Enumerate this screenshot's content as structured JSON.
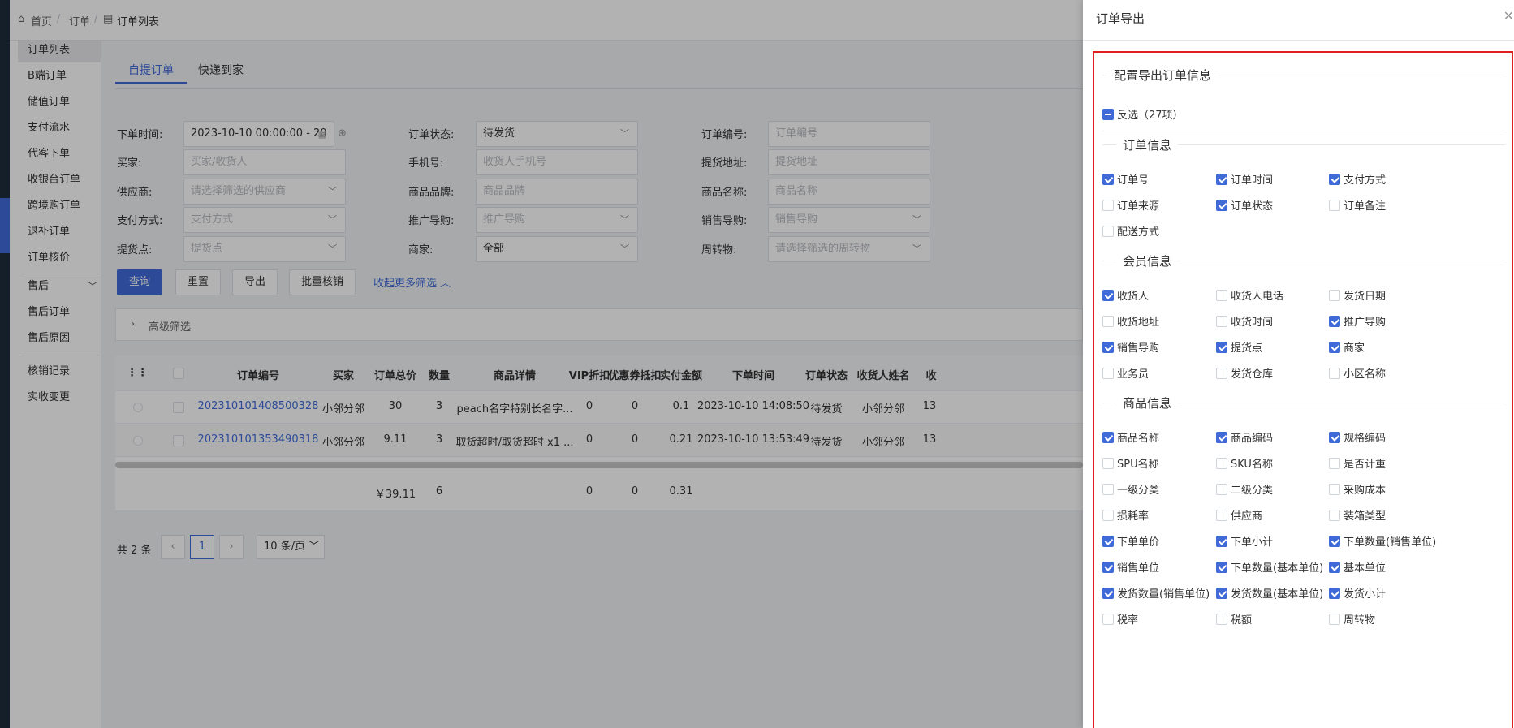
{
  "breadcrumb": [
    "首页",
    "订单",
    "订单列表"
  ],
  "sidebar": {
    "items": [
      "订单列表",
      "B端订单",
      "储值订单",
      "支付流水",
      "代客下单",
      "收银台订单",
      "跨境购订单",
      "退补订单",
      "订单核价",
      "售后",
      "售后订单",
      "售后原因",
      "核销记录",
      "实收变更"
    ]
  },
  "tabs": [
    "自提订单",
    "快递到家"
  ],
  "filters": {
    "order_time": {
      "label": "下单时间:",
      "value": "2023-10-10 00:00:00 - 20"
    },
    "order_status": {
      "label": "订单状态:",
      "value": "待发货"
    },
    "order_no": {
      "label": "订单编号:",
      "placeholder": "订单编号"
    },
    "buyer": {
      "label": "买家:",
      "placeholder": "买家/收货人"
    },
    "phone": {
      "label": "手机号:",
      "placeholder": "收货人手机号"
    },
    "pickup_addr": {
      "label": "提货地址:",
      "placeholder": "提货地址"
    },
    "supplier": {
      "label": "供应商:",
      "placeholder": "请选择筛选的供应商"
    },
    "brand": {
      "label": "商品品牌:",
      "placeholder": "商品品牌"
    },
    "product_name": {
      "label": "商品名称:",
      "placeholder": "商品名称"
    },
    "pay_method": {
      "label": "支付方式:",
      "placeholder": "支付方式"
    },
    "promoter": {
      "label": "推广导购:",
      "placeholder": "推广导购"
    },
    "sales_guide": {
      "label": "销售导购:",
      "placeholder": "销售导购"
    },
    "pickup_point": {
      "label": "提货点:",
      "placeholder": "提货点"
    },
    "merchant": {
      "label": "商家:",
      "value": "全部"
    },
    "turnover": {
      "label": "周转物:",
      "placeholder": "请选择筛选的周转物"
    }
  },
  "buttons": {
    "query": "查询",
    "reset": "重置",
    "export": "导出",
    "batch": "批量核销",
    "collapse": "收起更多筛选"
  },
  "advanced": "高级筛选",
  "table": {
    "headers": [
      "订单编号",
      "买家",
      "订单总价",
      "数量",
      "商品详情",
      "VIP折扣",
      "优惠券抵扣",
      "实付金额",
      "下单时间",
      "订单状态",
      "收货人姓名",
      "收"
    ],
    "rows": [
      [
        "202310101408500328",
        "小邻分邻",
        "30",
        "3",
        "peach名字特别长名字...",
        "0",
        "0",
        "0.1",
        "2023-10-10 14:08:50",
        "待发货",
        "小邻分邻",
        "13"
      ],
      [
        "202310101353490318",
        "小邻分邻",
        "9.11",
        "3",
        "取货超时/取货超时 x1 ...",
        "0",
        "0",
        "0.21",
        "2023-10-10 13:53:49",
        "待发货",
        "小邻分邻",
        "13"
      ]
    ],
    "summary": {
      "total": "￥39.11",
      "qty": "6",
      "vip": "0",
      "coupon": "0",
      "paid": "0.31"
    }
  },
  "pager": {
    "total": "共 2 条",
    "page": "1",
    "size": "10 条/页"
  },
  "drawer": {
    "title": "订单导出",
    "config_title": "配置导出订单信息",
    "invert_label": "反选（27项）",
    "sections": [
      {
        "title": "订单信息",
        "options": [
          {
            "label": "订单号",
            "checked": true
          },
          {
            "label": "订单时间",
            "checked": true
          },
          {
            "label": "支付方式",
            "checked": true
          },
          {
            "label": "订单来源",
            "checked": false
          },
          {
            "label": "订单状态",
            "checked": true
          },
          {
            "label": "订单备注",
            "checked": false
          },
          {
            "label": "配送方式",
            "checked": false
          }
        ]
      },
      {
        "title": "会员信息",
        "options": [
          {
            "label": "收货人",
            "checked": true
          },
          {
            "label": "收货人电话",
            "checked": false
          },
          {
            "label": "发货日期",
            "checked": false
          },
          {
            "label": "收货地址",
            "checked": false
          },
          {
            "label": "收货时间",
            "checked": false
          },
          {
            "label": "推广导购",
            "checked": true
          },
          {
            "label": "销售导购",
            "checked": true
          },
          {
            "label": "提货点",
            "checked": true
          },
          {
            "label": "商家",
            "checked": true
          },
          {
            "label": "业务员",
            "checked": false
          },
          {
            "label": "发货仓库",
            "checked": false
          },
          {
            "label": "小区名称",
            "checked": false
          }
        ]
      },
      {
        "title": "商品信息",
        "options": [
          {
            "label": "商品名称",
            "checked": true
          },
          {
            "label": "商品编码",
            "checked": true
          },
          {
            "label": "规格编码",
            "checked": true
          },
          {
            "label": "SPU名称",
            "checked": false
          },
          {
            "label": "SKU名称",
            "checked": false
          },
          {
            "label": "是否计重",
            "checked": false
          },
          {
            "label": "一级分类",
            "checked": false
          },
          {
            "label": "二级分类",
            "checked": false
          },
          {
            "label": "采购成本",
            "checked": false
          },
          {
            "label": "损耗率",
            "checked": false
          },
          {
            "label": "供应商",
            "checked": false
          },
          {
            "label": "装箱类型",
            "checked": false
          },
          {
            "label": "下单单价",
            "checked": true
          },
          {
            "label": "下单小计",
            "checked": true
          },
          {
            "label": "下单数量(销售单位)",
            "checked": true
          },
          {
            "label": "销售单位",
            "checked": true
          },
          {
            "label": "下单数量(基本单位)",
            "checked": true
          },
          {
            "label": "基本单位",
            "checked": true
          },
          {
            "label": "发货数量(销售单位)",
            "checked": true
          },
          {
            "label": "发货数量(基本单位)",
            "checked": true
          },
          {
            "label": "发货小计",
            "checked": true
          },
          {
            "label": "税率",
            "checked": false
          },
          {
            "label": "税额",
            "checked": false
          },
          {
            "label": "周转物",
            "checked": false
          }
        ]
      }
    ]
  },
  "colors": {
    "primary": "#3f6ad8",
    "highlight_border": "#e02020"
  }
}
